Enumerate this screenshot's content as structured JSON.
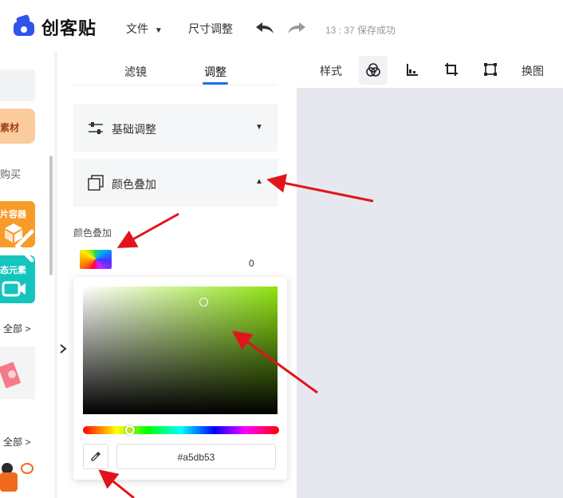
{
  "app": {
    "logo_text": "创客贴"
  },
  "topbar": {
    "file_menu": "文件",
    "size_adjust": "尺寸调整",
    "save_status": "13 : 37 保存成功"
  },
  "left_strip": {
    "material_label": "素材",
    "purchase_label": "购买",
    "image_container_label": "片容器",
    "dynamic_element_label": "态元素",
    "all_label_1": "全部 >",
    "all_label_2": "全部 >"
  },
  "panel": {
    "tabs": [
      {
        "label": "滤镜"
      },
      {
        "label": "调整"
      }
    ],
    "basic_adjust_label": "基础调整",
    "color_overlay_label": "颜色叠加",
    "overlay_field_label": "颜色叠加",
    "overlay_value": "0"
  },
  "toolbar": {
    "style_label": "样式",
    "replace_label": "换图"
  },
  "picker": {
    "hex_value": "#a5db53",
    "base_hue_color": "#8fe411"
  },
  "colors": {
    "accent": "#1a73e8",
    "logo_blue": "#2f54eb",
    "canvas_bg": "#e7e8ef",
    "orange_card": "#fbcc9d",
    "teal_card": "#14c5bd",
    "orange_icon_card": "#f99b2a"
  }
}
